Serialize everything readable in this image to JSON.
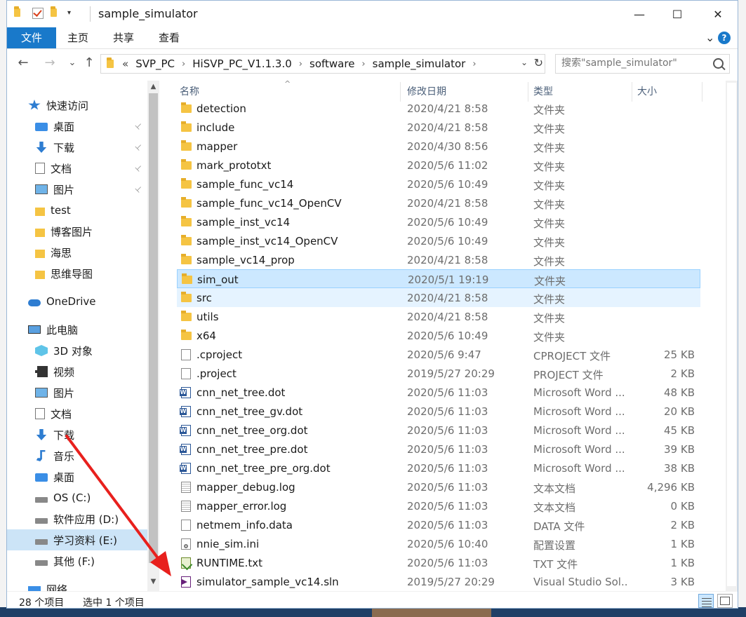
{
  "window": {
    "title": "sample_simulator",
    "controls": {
      "minimize": "—",
      "maximize": "☐",
      "close": "✕"
    }
  },
  "ribbon": {
    "tabs": [
      {
        "label": "文件"
      },
      {
        "label": "主页"
      },
      {
        "label": "共享"
      },
      {
        "label": "查看"
      }
    ],
    "expand_symbol": "⌄",
    "help_symbol": "?"
  },
  "nav": {
    "back": "←",
    "forward": "→",
    "recent": "⌄",
    "up": "↑",
    "breadcrumb_overflow": "«",
    "breadcrumb": [
      "SVP_PC",
      "HiSVP_PC_V1.1.3.0",
      "software",
      "sample_simulator"
    ],
    "crumb_separator": "›",
    "refresh": "↻",
    "dropdown": "⌄"
  },
  "search": {
    "placeholder": "搜索\"sample_simulator\""
  },
  "sidebar": {
    "items": [
      {
        "label": "快速访问",
        "icon": "star-icon",
        "pinned": false
      },
      {
        "label": "桌面",
        "icon": "desktop-icon",
        "pinned": true
      },
      {
        "label": "下载",
        "icon": "download-icon",
        "pinned": true
      },
      {
        "label": "文档",
        "icon": "documents-icon",
        "pinned": true
      },
      {
        "label": "图片",
        "icon": "pictures-icon",
        "pinned": true
      },
      {
        "label": "test",
        "icon": "folder-icon",
        "pinned": false
      },
      {
        "label": "博客图片",
        "icon": "folder-icon",
        "pinned": false
      },
      {
        "label": "海思",
        "icon": "folder-icon",
        "pinned": false
      },
      {
        "label": "思维导图",
        "icon": "folder-icon",
        "pinned": false
      },
      {
        "label": "OneDrive",
        "icon": "cloud-icon",
        "pinned": false
      },
      {
        "label": "此电脑",
        "icon": "computer-icon",
        "pinned": false
      },
      {
        "label": "3D 对象",
        "icon": "3d-objects-icon",
        "pinned": false
      },
      {
        "label": "视频",
        "icon": "videos-icon",
        "pinned": false
      },
      {
        "label": "图片",
        "icon": "pictures-icon",
        "pinned": false
      },
      {
        "label": "文档",
        "icon": "documents-icon",
        "pinned": false
      },
      {
        "label": "下载",
        "icon": "download-icon",
        "pinned": false
      },
      {
        "label": "音乐",
        "icon": "music-icon",
        "pinned": false
      },
      {
        "label": "桌面",
        "icon": "desktop-icon",
        "pinned": false
      },
      {
        "label": "OS (C:)",
        "icon": "drive-icon",
        "pinned": false
      },
      {
        "label": "软件应用 (D:)",
        "icon": "drive-icon",
        "pinned": false
      },
      {
        "label": "学习资料 (E:)",
        "icon": "drive-icon",
        "pinned": false,
        "selected": true
      },
      {
        "label": "其他 (F:)",
        "icon": "drive-icon",
        "pinned": false
      },
      {
        "label": "网络",
        "icon": "network-icon",
        "pinned": false
      }
    ],
    "pin_symbol": "📌"
  },
  "columns": {
    "name": "名称",
    "date": "修改日期",
    "type": "类型",
    "size": "大小"
  },
  "files": [
    {
      "name": "detection",
      "date": "2020/4/21 8:58",
      "type": "文件夹",
      "size": "",
      "icon": "folder-icon"
    },
    {
      "name": "include",
      "date": "2020/4/21 8:58",
      "type": "文件夹",
      "size": "",
      "icon": "folder-icon"
    },
    {
      "name": "mapper",
      "date": "2020/4/30 8:56",
      "type": "文件夹",
      "size": "",
      "icon": "folder-icon"
    },
    {
      "name": "mark_prototxt",
      "date": "2020/5/6 11:02",
      "type": "文件夹",
      "size": "",
      "icon": "folder-icon"
    },
    {
      "name": "sample_func_vc14",
      "date": "2020/5/6 10:49",
      "type": "文件夹",
      "size": "",
      "icon": "folder-icon"
    },
    {
      "name": "sample_func_vc14_OpenCV",
      "date": "2020/4/21 8:58",
      "type": "文件夹",
      "size": "",
      "icon": "folder-icon"
    },
    {
      "name": "sample_inst_vc14",
      "date": "2020/5/6 10:49",
      "type": "文件夹",
      "size": "",
      "icon": "folder-icon"
    },
    {
      "name": "sample_inst_vc14_OpenCV",
      "date": "2020/5/6 10:49",
      "type": "文件夹",
      "size": "",
      "icon": "folder-icon"
    },
    {
      "name": "sample_vc14_prop",
      "date": "2020/4/21 8:58",
      "type": "文件夹",
      "size": "",
      "icon": "folder-icon"
    },
    {
      "name": "sim_out",
      "date": "2020/5/1 19:19",
      "type": "文件夹",
      "size": "",
      "icon": "folder-icon",
      "state": "selected"
    },
    {
      "name": "src",
      "date": "2020/4/21 8:58",
      "type": "文件夹",
      "size": "",
      "icon": "folder-icon",
      "state": "hover"
    },
    {
      "name": "utils",
      "date": "2020/4/21 8:58",
      "type": "文件夹",
      "size": "",
      "icon": "folder-icon"
    },
    {
      "name": "x64",
      "date": "2020/5/6 10:49",
      "type": "文件夹",
      "size": "",
      "icon": "folder-icon"
    },
    {
      "name": ".cproject",
      "date": "2020/5/6 9:47",
      "type": "CPROJECT 文件",
      "size": "25 KB",
      "icon": "file-icon"
    },
    {
      "name": ".project",
      "date": "2019/5/27 20:29",
      "type": "PROJECT 文件",
      "size": "2 KB",
      "icon": "file-icon"
    },
    {
      "name": "cnn_net_tree.dot",
      "date": "2020/5/6 11:03",
      "type": "Microsoft Word ...",
      "size": "48 KB",
      "icon": "word-icon"
    },
    {
      "name": "cnn_net_tree_gv.dot",
      "date": "2020/5/6 11:03",
      "type": "Microsoft Word ...",
      "size": "20 KB",
      "icon": "word-icon"
    },
    {
      "name": "cnn_net_tree_org.dot",
      "date": "2020/5/6 11:03",
      "type": "Microsoft Word ...",
      "size": "45 KB",
      "icon": "word-icon"
    },
    {
      "name": "cnn_net_tree_pre.dot",
      "date": "2020/5/6 11:03",
      "type": "Microsoft Word ...",
      "size": "39 KB",
      "icon": "word-icon"
    },
    {
      "name": "cnn_net_tree_pre_org.dot",
      "date": "2020/5/6 11:03",
      "type": "Microsoft Word ...",
      "size": "38 KB",
      "icon": "word-icon"
    },
    {
      "name": "mapper_debug.log",
      "date": "2020/5/6 11:03",
      "type": "文本文档",
      "size": "4,296 KB",
      "icon": "text-file-icon"
    },
    {
      "name": "mapper_error.log",
      "date": "2020/5/6 11:03",
      "type": "文本文档",
      "size": "0 KB",
      "icon": "text-file-icon"
    },
    {
      "name": "netmem_info.data",
      "date": "2020/5/6 11:03",
      "type": "DATA 文件",
      "size": "2 KB",
      "icon": "file-icon"
    },
    {
      "name": "nnie_sim.ini",
      "date": "2020/5/6 10:40",
      "type": "配置设置",
      "size": "1 KB",
      "icon": "settings-file-icon"
    },
    {
      "name": "RUNTIME.txt",
      "date": "2020/5/6 11:03",
      "type": "TXT 文件",
      "size": "1 KB",
      "icon": "runtime-file-icon"
    },
    {
      "name": "simulator_sample_vc14.sln",
      "date": "2019/5/27 20:29",
      "type": "Visual Studio Sol...",
      "size": "3 KB",
      "icon": "visual-studio-solution-icon"
    }
  ],
  "status": {
    "count": "28 个项目",
    "selected": "选中 1 个项目"
  },
  "colors": {
    "accent": "#1979ca",
    "selection": "#cce8ff",
    "hover": "#e5f3ff",
    "annotation_arrow": "#e8201d"
  }
}
